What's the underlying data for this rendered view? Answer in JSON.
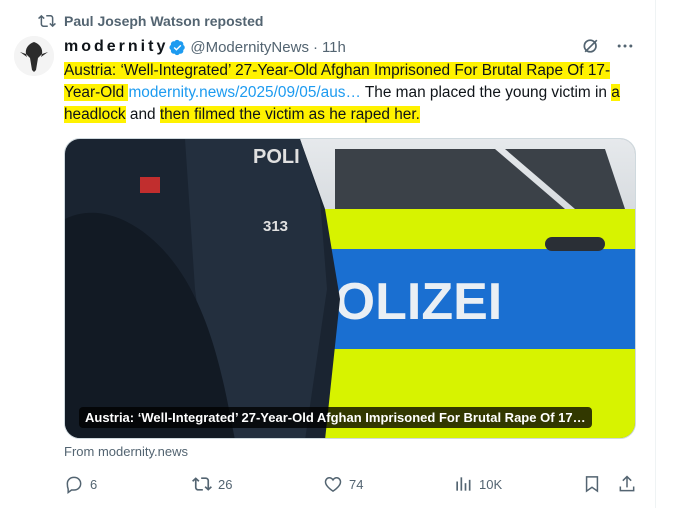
{
  "repost": {
    "label": "Paul Joseph Watson reposted",
    "icon": "repost-icon"
  },
  "author": {
    "name": "modernity",
    "handle": "@ModernityNews",
    "separator": "·",
    "time": "11h",
    "verified_color": "#1d9bf0"
  },
  "tweet": {
    "part1": "Austria: ‘Well-Integrated’ 27-Year-Old Afghan Imprisoned For Brutal Rape Of 17-Year-Old ",
    "link": "modernity.news/2025/09/05/aus…",
    "part2": " The man placed the young victim in ",
    "highlight2": "a headlock",
    "part3": " and ",
    "highlight3": "then filmed the victim as he raped her.",
    "highlight_color": "#fff200",
    "link_color": "#1d9bf0"
  },
  "media": {
    "caption": "Austria: ‘Well-Integrated’ 27-Year-Old Afghan Imprisoned For Brutal Rape Of 17…",
    "car_label": "POLIZEI",
    "vest_text1": "POLI",
    "vest_text2": "313"
  },
  "link_source": "From modernity.news",
  "actions": {
    "replies": "6",
    "reposts": "26",
    "likes": "74",
    "views": "10K"
  }
}
